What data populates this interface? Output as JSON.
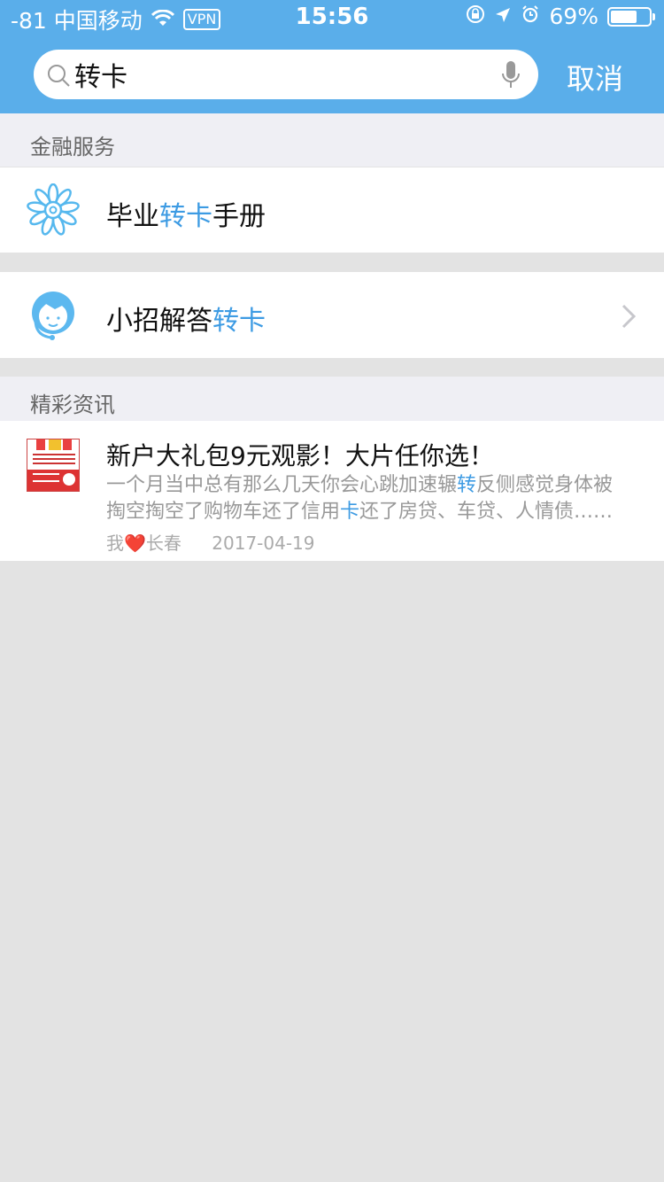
{
  "status_bar": {
    "carrier": "-81 中国移动",
    "vpn": "VPN",
    "time": "15:56",
    "battery": "69%",
    "battery_level": 0.69
  },
  "search": {
    "value": "转卡",
    "cancel_label": "取消"
  },
  "sections": {
    "finance_header": "金融服务",
    "news_header": "精彩资讯"
  },
  "finance_items": [
    {
      "pre": "毕业",
      "hl": "转卡",
      "post": "手册"
    },
    {
      "pre": "小招解答",
      "hl": "转卡",
      "post": ""
    }
  ],
  "news": {
    "title": "新户大礼包9元观影！大片任你选！",
    "body_1": "一个月当中总有那么几天你会心跳加速辗",
    "body_hl_1": "转",
    "body_2": "反侧感觉身体被",
    "body_3": "掏空掏空了购物车还了信用",
    "body_hl_2": "卡",
    "body_4": "还了房贷、车贷、人情债……",
    "author_pre": "我",
    "heart": "❤️",
    "author_post": "长春",
    "date": "2017-04-19"
  },
  "colors": {
    "accent": "#5aaeea",
    "highlight": "#3d9be3",
    "background": "#e3e3e3"
  }
}
